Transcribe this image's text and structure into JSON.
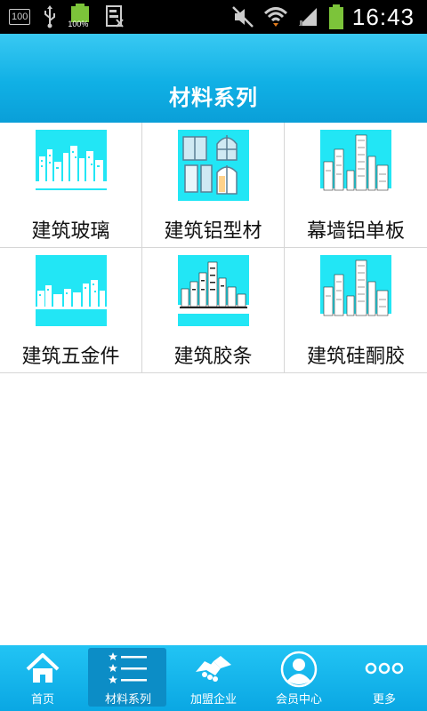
{
  "status_bar": {
    "badge": "100",
    "battery_percent": "100%",
    "time": "16:43"
  },
  "header": {
    "title": "材料系列"
  },
  "grid": {
    "items": [
      {
        "label": "建筑玻璃",
        "icon": "city-skyline-icon"
      },
      {
        "label": "建筑铝型材",
        "icon": "aluminum-windows-icon"
      },
      {
        "label": "幕墙铝单板",
        "icon": "skyscraper-icon"
      },
      {
        "label": "建筑五金件",
        "icon": "city-skyline-icon"
      },
      {
        "label": "建筑胶条",
        "icon": "city-skyline-icon"
      },
      {
        "label": "建筑硅酮胶",
        "icon": "skyscraper-icon"
      }
    ]
  },
  "tabbar": {
    "tabs": [
      {
        "label": "首页",
        "icon": "home-icon"
      },
      {
        "label": "材料系列",
        "icon": "list-icon",
        "active": true
      },
      {
        "label": "加盟企业",
        "icon": "handshake-icon"
      },
      {
        "label": "会员中心",
        "icon": "user-icon"
      },
      {
        "label": "更多",
        "icon": "more-icon"
      }
    ]
  },
  "colors": {
    "header": "#10b0e5",
    "tabbar": "#0aa7e3",
    "thumb": "#22e6f5"
  }
}
